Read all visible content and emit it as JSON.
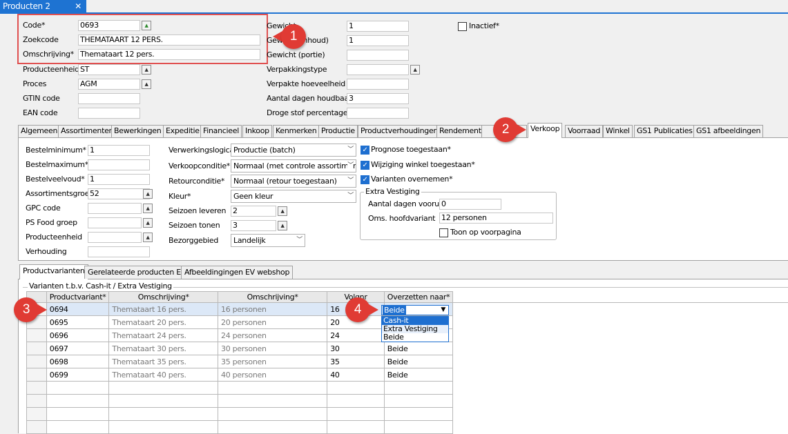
{
  "window_tab": {
    "title": "Producten 2",
    "close": "✕"
  },
  "header": {
    "code_label": "Code*",
    "code_value": "0693",
    "zoekcode_label": "Zoekcode",
    "zoekcode_value": "THEMATAART 12 PERS.",
    "omschrijving_label": "Omschrijving*",
    "omschrijving_value": "Themataart 12 pers.",
    "producteenheid_label": "Producteenheid",
    "producteenheid_value": "ST",
    "proces_label": "Proces",
    "proces_value": "AGM",
    "gtin_label": "GTIN code",
    "gtin_value": "",
    "ean_label": "EAN code",
    "ean_value": "",
    "gewicht_label": "Gewicht",
    "gewicht_value": "1",
    "gewicht_inhoud_label": "Gewicht (inhoud)",
    "gewicht_inhoud_value": "1",
    "gewicht_portie_label": "Gewicht (portie)",
    "gewicht_portie_value": "",
    "verpakkingstype_label": "Verpakkingstype",
    "verpakkingstype_value": "",
    "verpakte_label": "Verpakte hoeveelheid",
    "verpakte_value": "",
    "houdbaar_label": "Aantal dagen houdbaar",
    "houdbaar_value": "3",
    "droge_label": "Droge stof percentage",
    "droge_value": "",
    "inactief_label": "Inactief*"
  },
  "tabs": [
    "Algemeen",
    "Assortimenten",
    "Bewerkingen",
    "Expeditie",
    "Financieel",
    "Inkoop",
    "Kenmerken",
    "Productie",
    "Productverhoudingen",
    "Rendement",
    "",
    "Verkoop",
    "Voorraad",
    "Winkel",
    "GS1 Publicaties",
    "GS1 afbeeldingen"
  ],
  "verkoop": {
    "bestelminimum_label": "Bestelminimum*",
    "bestelminimum_value": "1",
    "bestelmaximum_label": "Bestelmaximum*",
    "bestelmaximum_value": "",
    "bestelveelvoud_label": "Bestelveelvoud*",
    "bestelveelvoud_value": "1",
    "assortimentsgroep_label": "Assortimentsgroep",
    "assortimentsgroep_value": "52",
    "gpc_label": "GPC code",
    "gpc_value": "",
    "psfood_label": "PS Food groep",
    "psfood_value": "",
    "producteenheid_label": "Producteenheid",
    "producteenheid_value": "",
    "verhouding_label": "Verhouding",
    "verhouding_value": "",
    "verwerkingslogica_label": "Verwerkingslogica",
    "verwerkingslogica_value": "Productie (batch)",
    "verkoopconditie_label": "Verkoopconditie*",
    "verkoopconditie_value": "Normaal (met controle assortiment",
    "retourconditie_label": "Retourconditie*",
    "retourconditie_value": "Normaal (retour toegestaan)",
    "kleur_label": "Kleur*",
    "kleur_value": "Geen kleur",
    "seizoen_leveren_label": "Seizoen leveren",
    "seizoen_leveren_value": "2",
    "seizoen_tonen_label": "Seizoen tonen",
    "seizoen_tonen_value": "3",
    "bezorggebied_label": "Bezorggebied",
    "bezorggebied_value": "Landelijk",
    "prognose_label": "Prognose toegestaan*",
    "wijziging_label": "Wijziging winkel toegestaan*",
    "varianten_label": "Varianten overnemen*",
    "extra_title": "Extra Vestiging",
    "dagen_vooruit_label": "Aantal dagen vooruit",
    "dagen_vooruit_value": "0",
    "hoofdvariant_label": "Oms. hoofdvariant",
    "hoofdvariant_value": "12 personen",
    "voorpagina_label": "Toon op voorpagina"
  },
  "subtabs": [
    "Productvarianten",
    "Gerelateerde producten EV",
    "Afbeeldingingen EV webshop"
  ],
  "grid": {
    "group_title": "Varianten t.b.v. Cash-it / Extra Vestiging",
    "headers": [
      "Productvariant*",
      "Omschrijving*",
      "Omschrijving*",
      "Volgnr",
      "Overzetten naar*"
    ],
    "rows": [
      [
        "0694",
        "Themataart 16 pers.",
        "16 personen",
        "16",
        "Beide"
      ],
      [
        "0695",
        "Themataart 20 pers.",
        "20 personen",
        "20",
        "Beide"
      ],
      [
        "0696",
        "Themataart 24 pers.",
        "24 personen",
        "24",
        "Beide"
      ],
      [
        "0697",
        "Themataart 30 pers.",
        "30 personen",
        "30",
        "Beide"
      ],
      [
        "0698",
        "Themataart 35 pers.",
        "35 personen",
        "35",
        "Beide"
      ],
      [
        "0699",
        "Themataart 40 pers.",
        "40 personen",
        "40",
        "Beide"
      ]
    ],
    "dropdown_options": [
      "Cash-it",
      "Extra Vestiging",
      "Beide"
    ]
  },
  "callouts": [
    "1",
    "2",
    "3",
    "4"
  ],
  "colors": {
    "accent": "#1e6fd0",
    "callout": "#e03b34",
    "highlight_box": "#e05050"
  }
}
